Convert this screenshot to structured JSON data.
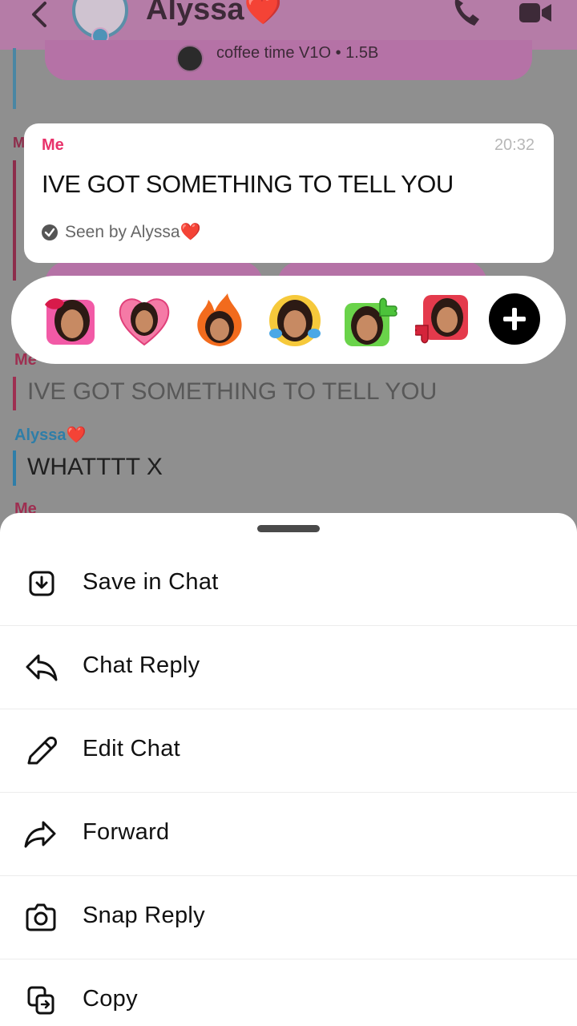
{
  "header": {
    "contact_name": "Alyssa❤️",
    "back_icon": "chevron-left-icon",
    "call_icon": "phone-icon",
    "video_icon": "video-camera-icon"
  },
  "snap_preview": {
    "text": "coffee time V1O  •  1.5B"
  },
  "background_chat": {
    "messages": [
      {
        "sender": "Me",
        "text": "IVE GOT SOMETHING TO TELL YOU"
      },
      {
        "sender": "Alyssa❤️",
        "text": "WHATTTT X"
      },
      {
        "sender": "Me",
        "text": ""
      }
    ],
    "partial_me": "M"
  },
  "focused_message": {
    "sender": "Me",
    "time": "20:32",
    "text": "IVE GOT SOMETHING TO TELL YOU",
    "seen": "Seen by Alyssa❤️"
  },
  "reactions": [
    {
      "name": "kiss-lips-reaction"
    },
    {
      "name": "heart-reaction"
    },
    {
      "name": "fire-reaction"
    },
    {
      "name": "crying-laughing-reaction"
    },
    {
      "name": "thumbs-up-reaction"
    },
    {
      "name": "thumbs-down-reaction"
    }
  ],
  "menu": {
    "items": [
      {
        "label": "Save in Chat",
        "icon": "save-download-icon"
      },
      {
        "label": "Chat Reply",
        "icon": "reply-arrow-icon"
      },
      {
        "label": "Edit Chat",
        "icon": "pencil-icon"
      },
      {
        "label": "Forward",
        "icon": "forward-arrow-icon"
      },
      {
        "label": "Snap Reply",
        "icon": "camera-icon"
      },
      {
        "label": "Copy",
        "icon": "copy-icon"
      }
    ]
  },
  "colors": {
    "me_accent": "#e8336b",
    "friend_accent": "#2f7ea8",
    "header_bg": "#b57ca7"
  }
}
